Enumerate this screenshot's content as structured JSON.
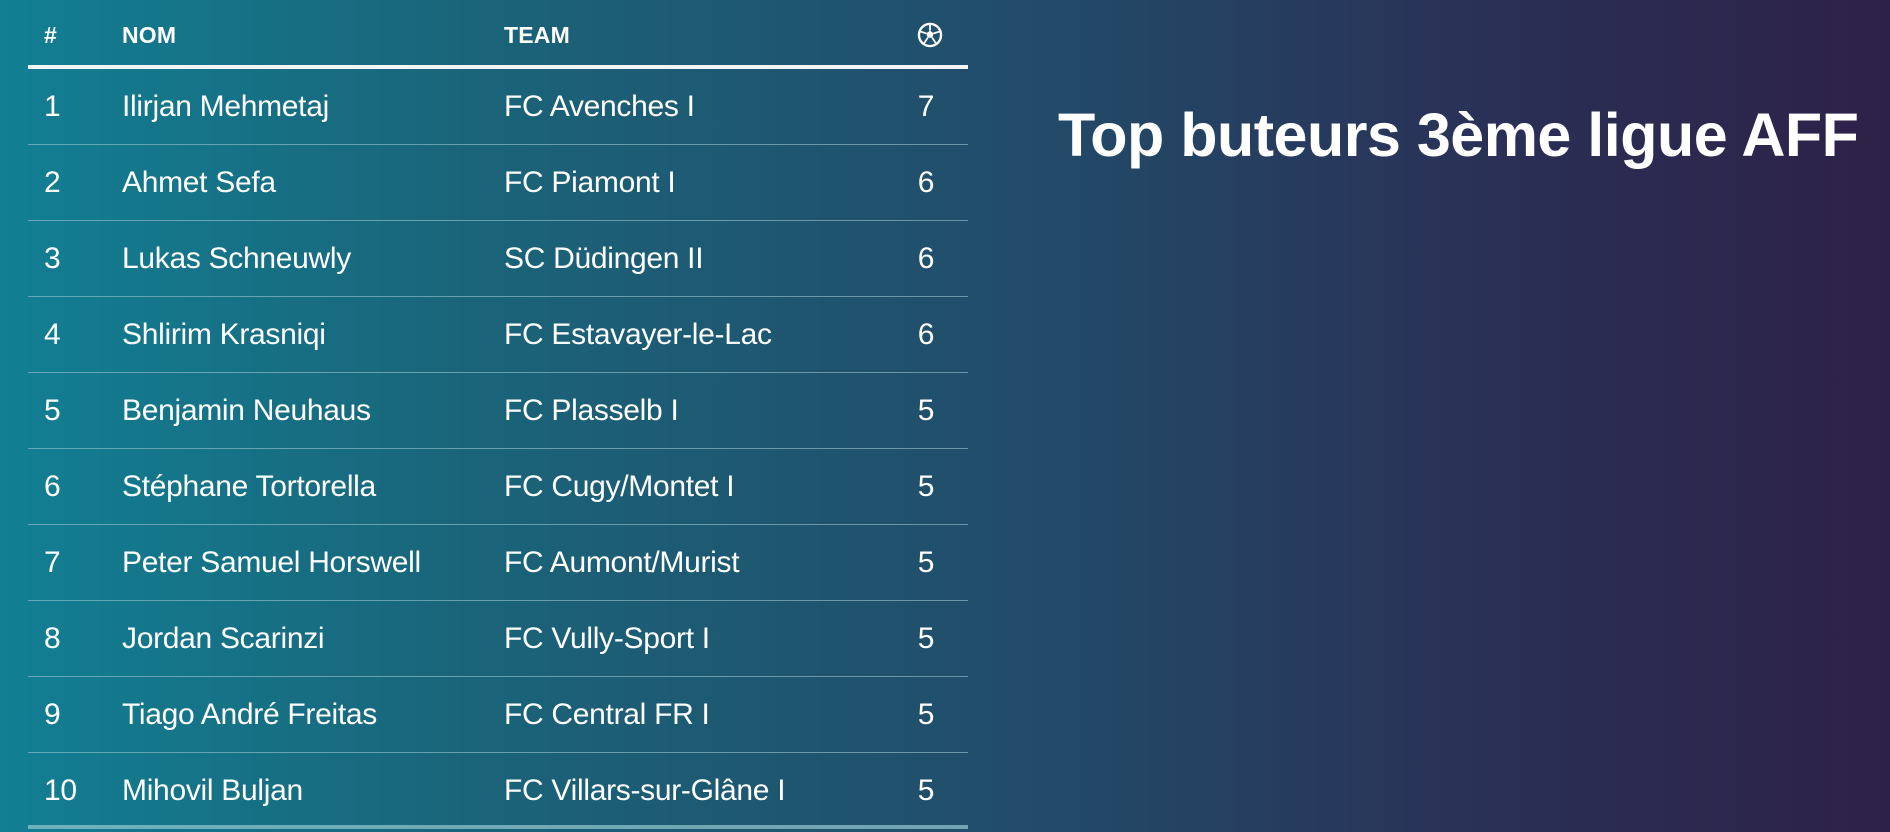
{
  "title": "Top buteurs 3ème ligue AFF",
  "table": {
    "headers": {
      "rank": "#",
      "name": "NOM",
      "team": "TEAM",
      "goals_icon": "soccer-ball-icon"
    },
    "rows": [
      {
        "rank": "1",
        "name": "Ilirjan Mehmetaj",
        "team": "FC Avenches I",
        "goals": "7"
      },
      {
        "rank": "2",
        "name": "Ahmet Sefa",
        "team": "FC Piamont I",
        "goals": "6"
      },
      {
        "rank": "3",
        "name": "Lukas Schneuwly",
        "team": "SC Düdingen II",
        "goals": "6"
      },
      {
        "rank": "4",
        "name": "Shlirim Krasniqi",
        "team": "FC Estavayer-le-Lac",
        "goals": "6"
      },
      {
        "rank": "5",
        "name": "Benjamin Neuhaus",
        "team": "FC Plasselb I",
        "goals": "5"
      },
      {
        "rank": "6",
        "name": "Stéphane Tortorella",
        "team": "FC Cugy/Montet I",
        "goals": "5"
      },
      {
        "rank": "7",
        "name": "Peter Samuel Horswell",
        "team": "FC Aumont/Murist",
        "goals": "5"
      },
      {
        "rank": "8",
        "name": "Jordan Scarinzi",
        "team": "FC Vully-Sport I",
        "goals": "5"
      },
      {
        "rank": "9",
        "name": "Tiago André Freitas",
        "team": "FC Central FR I",
        "goals": "5"
      },
      {
        "rank": "10",
        "name": "Mihovil Buljan",
        "team": "FC Villars-sur-Glâne I",
        "goals": "5"
      }
    ]
  },
  "colors": {
    "background_start": "#127f93",
    "background_end": "#2e2148",
    "text": "#ffffff"
  }
}
